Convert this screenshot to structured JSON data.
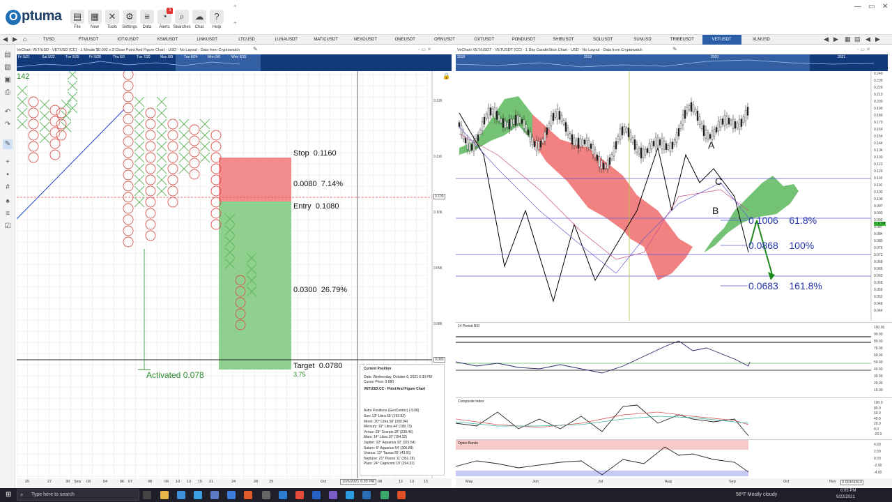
{
  "app": {
    "name": "Optuma",
    "logo_letter": "O",
    "rest": "ptuma"
  },
  "ribbon": [
    {
      "label": "File",
      "icon": "folder-icon",
      "glyph": "▤"
    },
    {
      "label": "New",
      "icon": "new-icon",
      "glyph": "▦"
    },
    {
      "label": "Tools",
      "icon": "tools-icon",
      "glyph": "✕"
    },
    {
      "label": "Settings",
      "icon": "gear-icon",
      "glyph": "⚙"
    },
    {
      "label": "Data",
      "icon": "data-icon",
      "glyph": "≡"
    },
    {
      "label": "Alerts",
      "icon": "alarm-icon",
      "glyph": "◔"
    },
    {
      "label": "Searches",
      "icon": "search-icon",
      "glyph": "⌕"
    },
    {
      "label": "Chat",
      "icon": "chat-icon",
      "glyph": "☁"
    },
    {
      "label": "Help",
      "icon": "help-icon",
      "glyph": "?"
    }
  ],
  "alerts_badge": "3",
  "tabs": [
    "TUSD",
    "FTMUSDT",
    "IOTXUSDT",
    "KSMUSDT",
    "LINKUSDT",
    "LTCUSD",
    "LUNAUSDT",
    "MATICUSDT",
    "NEXOUSDT",
    "ONEUSDT",
    "ORNUSDT",
    "OXTUSDT",
    "PONDUSDT",
    "SHIBUSDT",
    "SOLUSDT",
    "SUNUSD",
    "TRIBEUSDT",
    "VETUSDT",
    "XLMUSD"
  ],
  "active_tab": "VETUSDT",
  "left": {
    "title": "VeChain VET/USD - VETUSD (CC) - 1 Minute $0.002 x 3 Close Point And Figure Chart - USD - No Layout - Data from Cryptowatch",
    "strip_labels": [
      "Fri 5/21",
      "Sat 5/22",
      "Tue 5/25",
      "Fri 5/28",
      "Thu 6/3",
      "Tue 7/20",
      "Mon 8/9",
      "Tue 8/24",
      "Mon 9/6",
      "Wed 9/15"
    ],
    "counter": "142",
    "stop_label": "Stop",
    "stop_value": "0.1160",
    "risk_value": "0.0080",
    "risk_pct": "7.14%",
    "entry_label": "Entry",
    "entry_value": "0.1080",
    "reward_value": "0.0300",
    "reward_pct": "26.79%",
    "target_label": "Target",
    "target_value": "0.0780",
    "rr": "3.75",
    "activated": "Activated 0.078",
    "yaxis": [
      "0.126",
      "0.116",
      "0.109",
      "0.106",
      "0.096",
      "0.086",
      "0.080"
    ],
    "xaxis": [
      "25",
      "27",
      "30",
      "Sep",
      "03",
      "04",
      "06",
      "07",
      "08",
      "09",
      "10",
      "13",
      "15",
      "21",
      "24",
      "28",
      "29",
      "Oct",
      "12",
      "13",
      "15"
    ],
    "cursor_date": "10/6/2021 6:30 PM",
    "cursor_day": "08"
  },
  "infobox": {
    "title": "Current Position",
    "date": "Date: Wednesday, October 6, 2021 6:30 PM",
    "cursor": "Cursor Price: 0.080",
    "chart": "VETUSD:CC - Point And Figure Chart",
    "astro_title": "Astro Positions (GeoCentric) (-5:00)",
    "astro": [
      "Sun: 13° Libra 55' (193.92)",
      "Moon: 20° Libra 56' (200.94)",
      "Mercury: 19° Libra 44' (199.73)",
      "Venus: 29° Scorpio 28' (239.46)",
      "Mars: 14° Libra 19' (194.32)",
      "Jupiter: 22° Aquarius 32' (322.54)",
      "Saturn: 6° Aquarius 54' (306.89)",
      "Uranus: 13° Taurus 55' (43.91)",
      "Neptune: 21° Pisces 11' (351.18)",
      "Pluto: 24° Capricorn 19' (294.31)"
    ]
  },
  "right": {
    "title": "VeChain VET/USDT - VETUSDT (CC) - 1 Day CandleStick Chart - USD - No Layout - Data from Cryptowatch",
    "strip_labels": [
      "2018",
      "2019",
      "2020",
      "2021"
    ],
    "fib": [
      {
        "price": "0.1006",
        "pct": "61.8%"
      },
      {
        "price": "0.0868",
        "pct": "100%"
      },
      {
        "price": "0.0683",
        "pct": "161.8%"
      }
    ],
    "points": {
      "A": "A",
      "B": "B",
      "C": "C"
    },
    "yaxis": [
      "0.240",
      "0.230",
      "0.220",
      "0.210",
      "0.200",
      "0.190",
      "0.180",
      "0.170",
      "0.164",
      "0.154",
      "0.144",
      "0.134",
      "0.130",
      "0.123",
      "0.120",
      "0.116",
      "0.110",
      "0.103",
      "0.100",
      "0.097",
      "0.093",
      "0.090",
      "0.087",
      "0.084",
      "0.080",
      "0.076",
      "0.072",
      "0.068",
      "0.066",
      "0.062",
      "0.058",
      "0.056",
      "0.052",
      "0.048",
      "0.044"
    ],
    "price_tag": "0.1038",
    "xaxis": [
      "May",
      "Jun",
      "Jul",
      "Aug",
      "Sep",
      "Oct",
      "Nov"
    ],
    "rsi_label": "14 Period RSI",
    "rsi_axis": [
      "100.00",
      "90.00",
      "80.00",
      "70.00",
      "60.00",
      "50.00",
      "40.00",
      "30.00",
      "20.00",
      "10.00"
    ],
    "ci_label": "Composite Index",
    "ci_axis": [
      "100.0",
      "80.0",
      "60.0",
      "40.0",
      "20.0",
      "0.0",
      "-20.0"
    ],
    "optex_label": "Optex Bands",
    "optex_axis": [
      "4.00",
      "2.00",
      "0.00",
      "-2.00",
      "-4.00"
    ],
    "bottom_val": "0.00161510"
  },
  "taskbar": {
    "search": "Type here to search",
    "weather": "58°F  Mostly cloudy",
    "time": "6:05 PM",
    "date": "9/22/2021"
  },
  "colors": {
    "stop_zone": "#f28b8b",
    "target_zone": "#8fd08f",
    "cloud_bull": "#5cb85c",
    "cloud_bear": "#f06b6b",
    "strip": "#123a7a",
    "active_tab": "#2a5fa8"
  }
}
